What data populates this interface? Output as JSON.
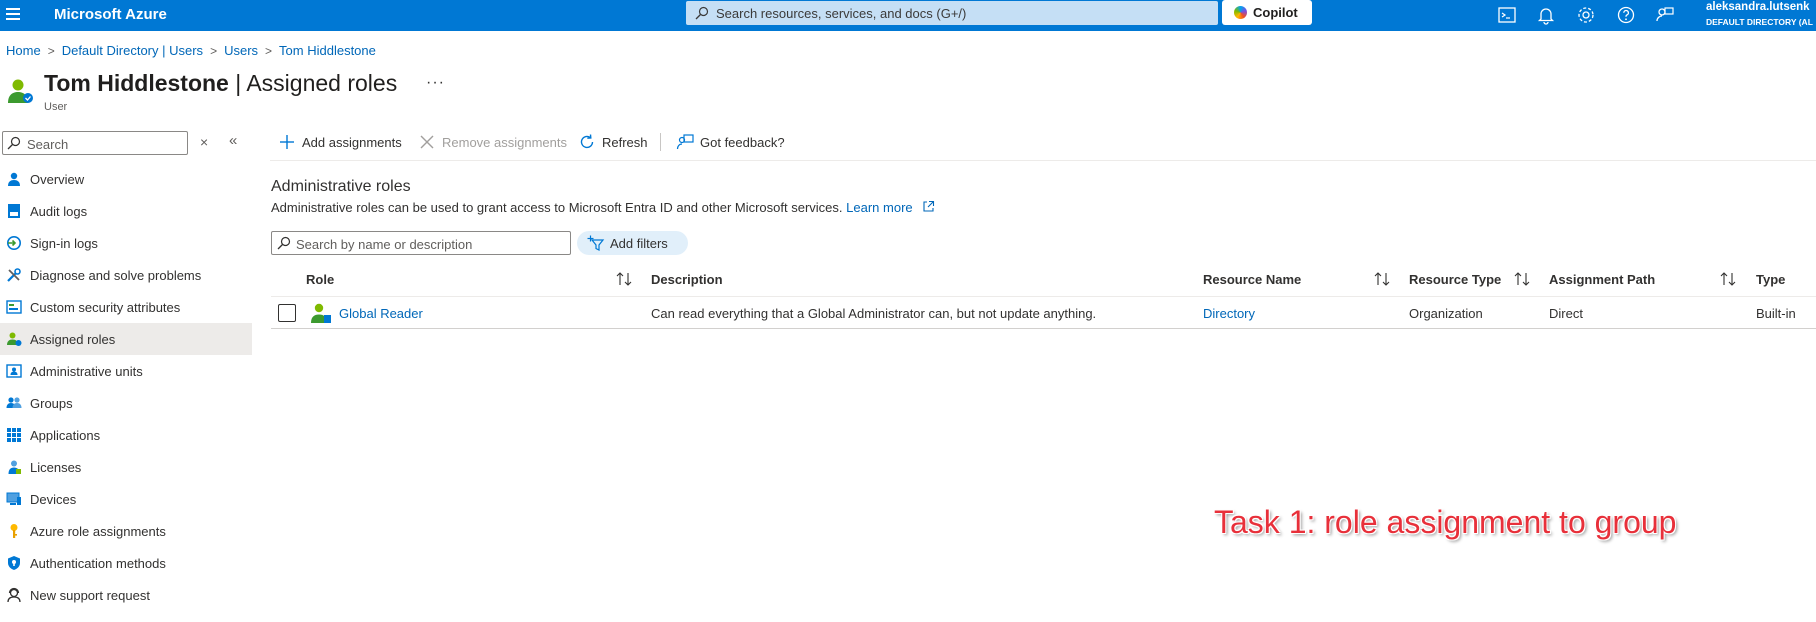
{
  "topbar": {
    "brand": "Microsoft Azure",
    "search_placeholder": "Search resources, services, and docs (G+/)",
    "copilot_label": "Copilot",
    "icons": [
      "cloud-shell-icon",
      "notifications-icon",
      "settings-icon",
      "help-icon",
      "feedback-icon"
    ],
    "user_name": "aleksandra.lutsenk",
    "user_directory": "DEFAULT DIRECTORY (AL"
  },
  "breadcrumb": [
    "Home",
    "Default Directory | Users",
    "Users",
    "Tom Hiddlestone"
  ],
  "page": {
    "title_bold": "Tom Hiddlestone",
    "title_rest": "| Assigned roles",
    "more": "···",
    "subtitle": "User"
  },
  "sidebar": {
    "search_placeholder": "Search",
    "clear": "×",
    "collapse": "«",
    "items": [
      {
        "label": "Overview",
        "icon": "user-icon"
      },
      {
        "label": "Audit logs",
        "icon": "audit-log-icon"
      },
      {
        "label": "Sign-in logs",
        "icon": "sign-in-icon"
      },
      {
        "label": "Diagnose and solve problems",
        "icon": "wrench-icon"
      },
      {
        "label": "Custom security attributes",
        "icon": "attributes-icon"
      },
      {
        "label": "Assigned roles",
        "icon": "assigned-roles-icon",
        "active": true
      },
      {
        "label": "Administrative units",
        "icon": "admin-units-icon"
      },
      {
        "label": "Groups",
        "icon": "groups-icon"
      },
      {
        "label": "Applications",
        "icon": "apps-grid-icon"
      },
      {
        "label": "Licenses",
        "icon": "license-icon"
      },
      {
        "label": "Devices",
        "icon": "device-icon"
      },
      {
        "label": "Azure role assignments",
        "icon": "key-icon"
      },
      {
        "label": "Authentication methods",
        "icon": "shield-icon"
      },
      {
        "label": "New support request",
        "icon": "support-icon"
      }
    ]
  },
  "toolbar": {
    "add": "Add assignments",
    "remove": "Remove assignments",
    "refresh": "Refresh",
    "feedback": "Got feedback?"
  },
  "section": {
    "title": "Administrative roles",
    "description": "Administrative roles can be used to grant access to Microsoft Entra ID and other Microsoft services.",
    "learn_more": "Learn more",
    "search_placeholder": "Search by name or description",
    "add_filters": "Add filters"
  },
  "table": {
    "columns": [
      "Role",
      "Description",
      "Resource Name",
      "Resource Type",
      "Assignment Path",
      "Type"
    ],
    "rows": [
      {
        "role": "Global Reader",
        "description": "Can read everything that a Global Administrator can, but not update anything.",
        "resource_name": "Directory",
        "resource_type": "Organization",
        "assignment_path": "Direct",
        "type": "Built-in"
      }
    ]
  },
  "annotation": "Task 1: role assignment to group",
  "colors": {
    "accent": "#0078d4",
    "link": "#0067b8",
    "annotation": "#e8303a"
  }
}
